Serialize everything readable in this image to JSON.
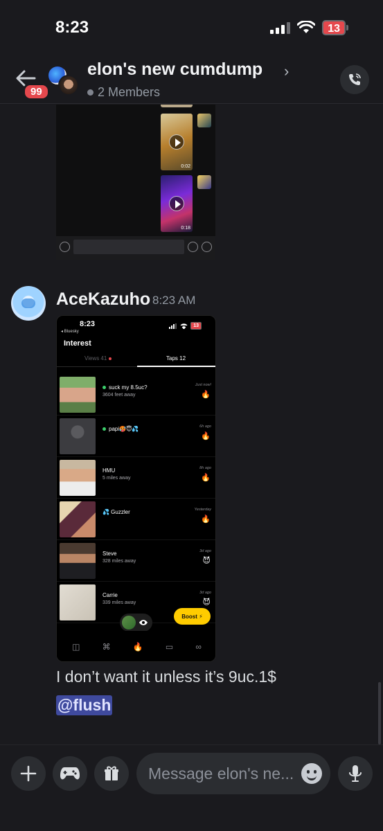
{
  "status_bar": {
    "time": "8:23",
    "battery": "13"
  },
  "header": {
    "unread_badge": "99",
    "channel_name": "elon's new cumdump",
    "chevron": "›",
    "members": "2 Members"
  },
  "top_screenshot": {
    "videos": [
      {
        "duration": "0:02"
      },
      {
        "duration": "0:18"
      }
    ]
  },
  "message": {
    "author": "AceKazuho",
    "time": "8:23 AM",
    "text": "I don’t want it unless it’s 9uc.1$",
    "mention": "@flush"
  },
  "phone_screenshot": {
    "time": "8:23",
    "back_label": "◂ Bluesky",
    "battery": "13",
    "heading": "Interest",
    "tabs": [
      {
        "label": "Views  41"
      },
      {
        "label": "Taps  12"
      }
    ],
    "rows": [
      {
        "name": "suck my 8.5uc?",
        "distance": "3604 feet away",
        "when": "Just now!",
        "reaction": "🔥",
        "online": true
      },
      {
        "name": "papi🥵😇💦",
        "distance": "",
        "when": "6h ago",
        "reaction": "🔥",
        "online": true
      },
      {
        "name": "HMU",
        "distance": "5 miles away",
        "when": "8h ago",
        "reaction": "🔥",
        "online": false
      },
      {
        "name": "💦 Guzzler",
        "distance": "",
        "when": "Yesterday",
        "reaction": "🔥",
        "online": false
      },
      {
        "name": "Steve",
        "distance": "328 miles away",
        "when": "3d ago",
        "reaction": "😈",
        "online": false
      },
      {
        "name": "Carrie",
        "distance": "339 miles away",
        "when": "3d ago",
        "reaction": "😈",
        "online": false
      }
    ],
    "boost_label": "Boost ⚡",
    "nav_icons": [
      "mask-icon",
      "browse-icon",
      "flame-icon",
      "chat-icon",
      "infinity-icon"
    ]
  },
  "composer": {
    "placeholder": "Message elon's ne..."
  },
  "colors": {
    "accent": "#3f4a9e",
    "badge": "#e5484d",
    "boost": "#ffcc00"
  }
}
